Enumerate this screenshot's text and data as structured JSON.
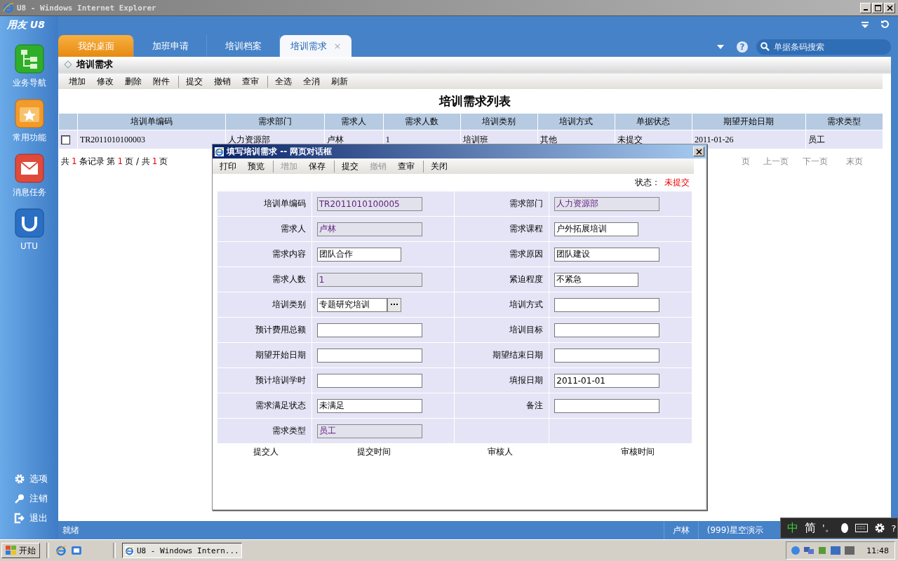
{
  "window": {
    "title": "U8 - Windows Internet Explorer"
  },
  "app": {
    "logo": "用友 U8",
    "help": "?",
    "search": {
      "placeholder": "单据条码搜索"
    }
  },
  "sidebar": {
    "items": [
      {
        "label": "业务导航",
        "kind": "nav"
      },
      {
        "label": "常用功能",
        "kind": "star"
      },
      {
        "label": "消息任务",
        "kind": "mail"
      },
      {
        "label": "UTU",
        "kind": "utu"
      }
    ],
    "bottom": [
      {
        "label": "选项",
        "kind": "gear"
      },
      {
        "label": "注销",
        "kind": "key"
      },
      {
        "label": "退出",
        "kind": "exit"
      }
    ]
  },
  "tabs": [
    {
      "label": "我的桌面",
      "kind": "home",
      "selected": false
    },
    {
      "label": "加班申请",
      "kind": "normal",
      "selected": false
    },
    {
      "label": "培训档案",
      "kind": "normal",
      "selected": false
    },
    {
      "label": "培训需求",
      "kind": "normal",
      "selected": true,
      "close": "×"
    }
  ],
  "breadcrumb": "培训需求",
  "toolbar": [
    {
      "label": "增加",
      "separator_before": false
    },
    {
      "label": "修改",
      "separator_before": false
    },
    {
      "label": "删除",
      "separator_before": false
    },
    {
      "label": "附件",
      "separator_before": false
    },
    {
      "label": "提交",
      "separator_before": true
    },
    {
      "label": "撤销",
      "separator_before": false
    },
    {
      "label": "查审",
      "separator_before": false
    },
    {
      "label": "全选",
      "separator_before": true
    },
    {
      "label": "全消",
      "separator_before": false
    },
    {
      "label": "刷新",
      "separator_before": false
    }
  ],
  "list_title": "培训需求列表",
  "table": {
    "columns": [
      "培训单编码",
      "需求部门",
      "需求人",
      "需求人数",
      "培训类别",
      "培训方式",
      "单据状态",
      "期望开始日期",
      "需求类型"
    ],
    "rows": [
      {
        "checked": false,
        "cells": [
          "TR2011010100003",
          "人力资源部",
          "卢林",
          "1",
          "培训班",
          "其他",
          "未提交",
          "2011-01-26",
          "员工"
        ]
      }
    ]
  },
  "pager": {
    "summary": [
      {
        "text": "共",
        "highlight": false
      },
      {
        "text": "1",
        "highlight": true
      },
      {
        "text": "条记录 第",
        "highlight": false
      },
      {
        "text": "1",
        "highlight": true
      },
      {
        "text": "页 / 共",
        "highlight": false
      },
      {
        "text": "1",
        "highlight": true
      },
      {
        "text": "页",
        "highlight": false
      }
    ],
    "links": [
      "页",
      "上一页",
      "下一页",
      "末页"
    ]
  },
  "dialog": {
    "title": "填写培训需求 -- 网页对话框",
    "toolbar": [
      {
        "label": "打印",
        "disabled": false,
        "separator_before": false
      },
      {
        "label": "预览",
        "disabled": false,
        "separator_before": false
      },
      {
        "label": "增加",
        "disabled": true,
        "separator_before": true
      },
      {
        "label": "保存",
        "disabled": false,
        "separator_before": false
      },
      {
        "label": "提交",
        "disabled": false,
        "separator_before": true
      },
      {
        "label": "撤销",
        "disabled": true,
        "separator_before": false
      },
      {
        "label": "查审",
        "disabled": false,
        "separator_before": false
      },
      {
        "label": "关闭",
        "disabled": false,
        "separator_before": true
      }
    ],
    "status_label": "状态：",
    "status_value": "未提交",
    "rows": [
      {
        "left": {
          "label": "培训单编码",
          "value": "TR2011010100005",
          "readonly": true,
          "wide": true,
          "lookup": false
        },
        "right": {
          "label": "需求部门",
          "value": "人力资源部",
          "readonly": true,
          "wide": true,
          "lookup": false
        }
      },
      {
        "left": {
          "label": "需求人",
          "value": "卢林",
          "readonly": true,
          "wide": true,
          "lookup": false
        },
        "right": {
          "label": "需求课程",
          "value": "户外拓展培训",
          "readonly": false,
          "wide": false,
          "lookup": false
        }
      },
      {
        "left": {
          "label": "需求内容",
          "value": "团队合作",
          "readonly": false,
          "wide": false,
          "lookup": false
        },
        "right": {
          "label": "需求原因",
          "value": "团队建设",
          "readonly": false,
          "wide": true,
          "lookup": false
        }
      },
      {
        "left": {
          "label": "需求人数",
          "value": "1",
          "readonly": true,
          "wide": true,
          "lookup": false
        },
        "right": {
          "label": "紧迫程度",
          "value": "不紧急",
          "readonly": false,
          "wide": false,
          "lookup": false
        }
      },
      {
        "left": {
          "label": "培训类别",
          "value": "专题研究培训",
          "readonly": false,
          "wide": false,
          "lookup": true
        },
        "right": {
          "label": "培训方式",
          "readonly": false,
          "wide": true,
          "lookup": false
        }
      },
      {
        "left": {
          "label": "预计费用总额",
          "readonly": false,
          "wide": true,
          "lookup": false
        },
        "right": {
          "label": "培训目标",
          "readonly": false,
          "wide": true,
          "lookup": false
        }
      },
      {
        "left": {
          "label": "期望开始日期",
          "readonly": false,
          "wide": true,
          "lookup": false
        },
        "right": {
          "label": "期望结束日期",
          "readonly": false,
          "wide": true,
          "lookup": false
        }
      },
      {
        "left": {
          "label": "预计培训学时",
          "readonly": false,
          "wide": true,
          "lookup": false
        },
        "right": {
          "label": "填报日期",
          "value": "2011-01-01",
          "readonly": false,
          "wide": true,
          "lookup": false
        }
      },
      {
        "left": {
          "label": "需求满足状态",
          "value": "未满足",
          "readonly": false,
          "wide": true,
          "lookup": false
        },
        "right": {
          "label": "备注",
          "readonly": false,
          "wide": true,
          "lookup": false
        }
      },
      {
        "left": {
          "label": "需求类型",
          "value": "员工",
          "readonly": true,
          "wide": true,
          "lookup": false
        },
        "right": null
      }
    ],
    "footer": [
      "提交人",
      "提交时间",
      "审核人",
      "审核时间"
    ]
  },
  "status_bar": {
    "message": "就绪",
    "user": "卢林",
    "account": "(999)星空演示"
  },
  "ime": {
    "mode": "中",
    "script": "简",
    "punct": "'。",
    "help": "?"
  },
  "taskbar": {
    "start": "开始",
    "task": "U8 - Windows Intern...",
    "clock": "11:48"
  }
}
